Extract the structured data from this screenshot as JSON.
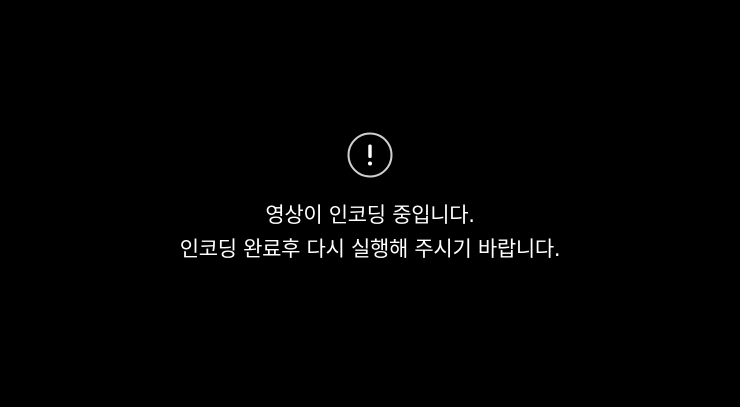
{
  "player": {
    "background": "#000000",
    "notice": {
      "icon": "exclamation-circle-icon",
      "icon_color": "#cfcfcf",
      "text_color": "#ffffff",
      "line1": "영상이 인코딩 중입니다.",
      "line2": "인코딩 완료후 다시 실행해 주시기 바랍니다."
    }
  }
}
